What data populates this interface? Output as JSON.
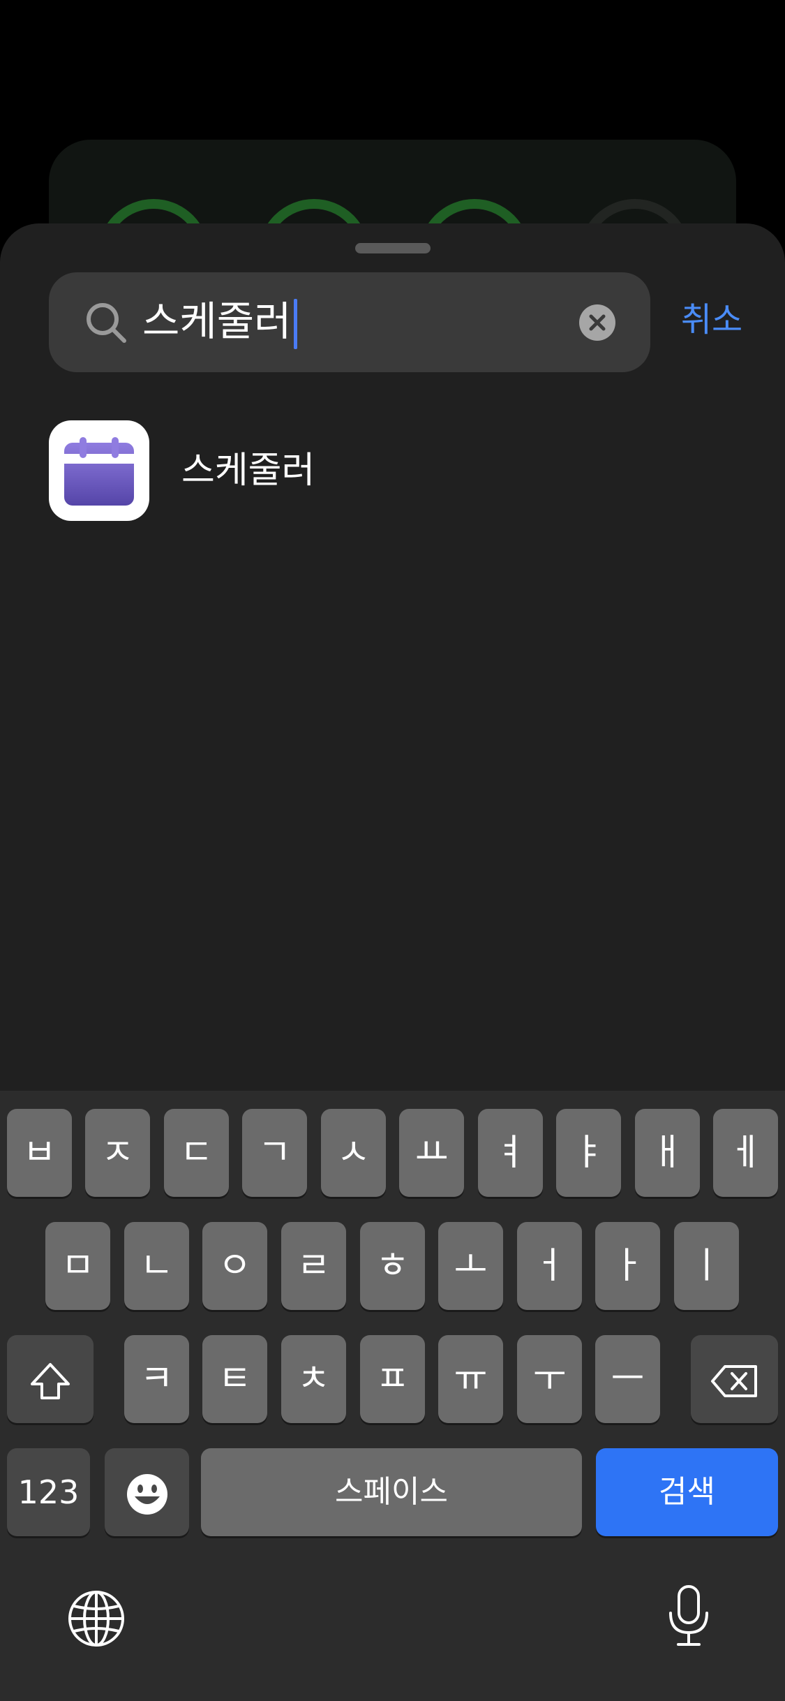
{
  "search": {
    "query": "스케줄러",
    "cancel_label": "취소"
  },
  "results": [
    {
      "label": "스케줄러",
      "icon": "calendar-app-icon"
    }
  ],
  "keyboard": {
    "row1": [
      "ㅂ",
      "ㅈ",
      "ㄷ",
      "ㄱ",
      "ㅅ",
      "ㅛ",
      "ㅕ",
      "ㅑ",
      "ㅐ",
      "ㅔ"
    ],
    "row2": [
      "ㅁ",
      "ㄴ",
      "ㅇ",
      "ㄹ",
      "ㅎ",
      "ㅗ",
      "ㅓ",
      "ㅏ",
      "ㅣ"
    ],
    "row3": [
      "ㅋ",
      "ㅌ",
      "ㅊ",
      "ㅍ",
      "ㅠ",
      "ㅜ",
      "ㅡ"
    ],
    "numbers_label": "123",
    "space_label": "스페이스",
    "search_label": "검색"
  },
  "colors": {
    "accent": "#2e74f5",
    "cancel": "#4a8cf7",
    "caret": "#4a7cf5"
  }
}
